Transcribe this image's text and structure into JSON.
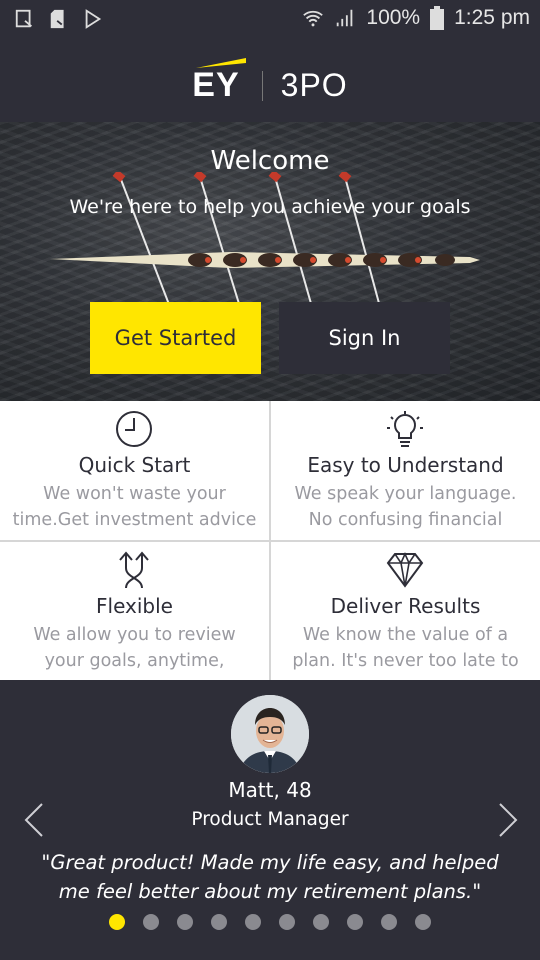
{
  "status_bar": {
    "battery": "100%",
    "time": "1:25 pm"
  },
  "header": {
    "brand": "EY",
    "app_name": "3PO"
  },
  "hero": {
    "title": "Welcome",
    "subtitle": "We're here to help you achieve your goals",
    "get_started_label": "Get Started",
    "sign_in_label": "Sign In"
  },
  "features": [
    {
      "icon": "clock-icon",
      "title": "Quick Start",
      "line1": "We won't waste your",
      "line2": "time.Get investment advice"
    },
    {
      "icon": "lightbulb-icon",
      "title": "Easy to Understand",
      "line1": "We speak your language.",
      "line2": "No confusing financial"
    },
    {
      "icon": "split-arrows-icon",
      "title": "Flexible",
      "line1": "We allow you to review",
      "line2": "your goals, anytime,"
    },
    {
      "icon": "diamond-icon",
      "title": "Deliver Results",
      "line1": "We know the value of a",
      "line2": "plan. It's never too late to"
    }
  ],
  "testimonial": {
    "name": "Matt, 48",
    "role": "Product Manager",
    "quote": "\"Great product! Made my life easy, and helped me feel better about my retirement plans.\"",
    "total_slides": 10,
    "active_slide": 1
  },
  "colors": {
    "accent": "#ffe600",
    "dark": "#2e2e38",
    "muted_text": "#9a9aa0"
  }
}
